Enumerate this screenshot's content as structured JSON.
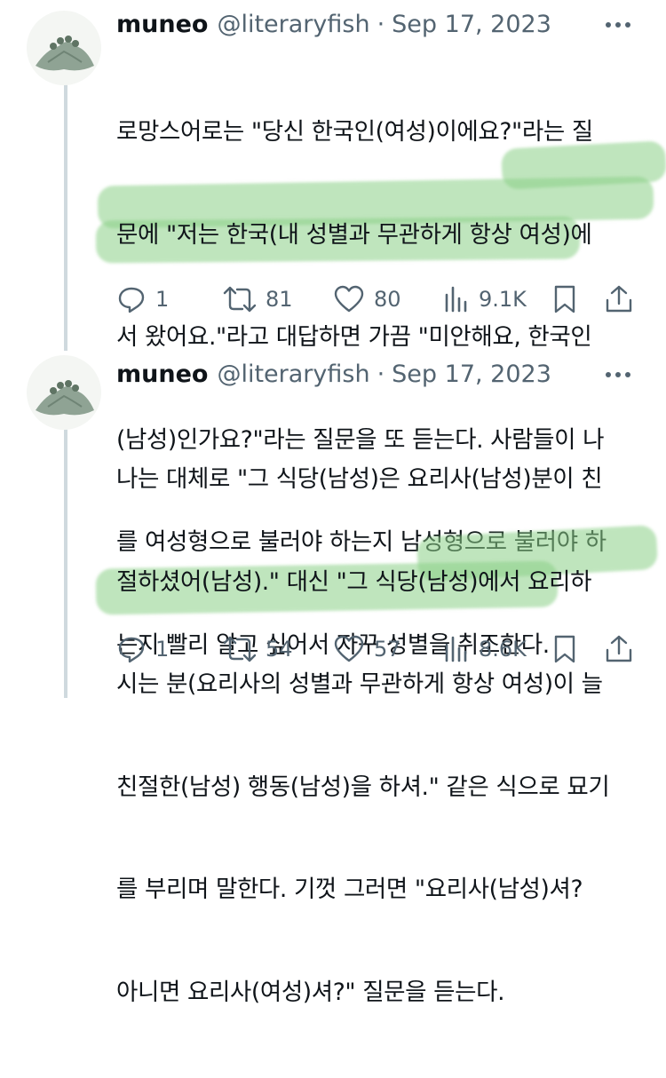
{
  "tweets": [
    {
      "author_name": "muneo",
      "handle": "@literaryfish",
      "separator": "·",
      "date": "Sep 17, 2023",
      "more_icon": "more-horizontal-icon",
      "lines": [
        "로망스어로는 \"당신 한국인(여성)이에요?\"라는 질",
        "문에 \"저는 한국(내 성별과 무관하게 항상 여성)에",
        "서 왔어요.\"라고 대답하면 가끔 \"미안해요, 한국인",
        "(남성)인가요?\"라는 질문을 또 듣는다. 사람들이 나",
        "를 여성형으로 불러야 하는지 남성형으로 불러야 하",
        "는지 빨리 알고 싶어서 자꾸 성별을 취조한다."
      ],
      "replies": "1",
      "retweets": "81",
      "likes": "80",
      "views": "9.1K"
    },
    {
      "author_name": "muneo",
      "handle": "@literaryfish",
      "separator": "·",
      "date": "Sep 17, 2023",
      "more_icon": "more-horizontal-icon",
      "lines": [
        "나는 대체로 \"그 식당(남성)은 요리사(남성)분이 친",
        "절하셨어(남성).\" 대신 \"그 식당(남성)에서 요리하",
        "시는 분(요리사의 성별과 무관하게 항상 여성)이 늘",
        "친절한(남성) 행동(남성)을 하셔.\" 같은 식으로 묘기",
        "를 부리며 말한다. 기껏 그러면 \"요리사(남성)셔?",
        "아니면 요리사(여성)셔?\" 질문을 듣는다."
      ],
      "replies": "1",
      "retweets": "54",
      "likes": "57",
      "views": "8.6K"
    }
  ],
  "colors": {
    "text": "#0f1419",
    "secondary": "#536471",
    "thread_line": "#cfd9de",
    "highlight": "#8bcf86"
  },
  "icons": {
    "reply": "reply-icon",
    "retweet": "retweet-icon",
    "like": "heart-icon",
    "views": "views-icon",
    "bookmark": "bookmark-icon",
    "share": "share-icon"
  }
}
